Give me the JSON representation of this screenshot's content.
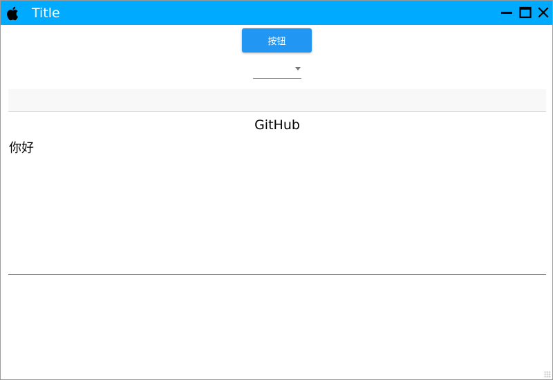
{
  "window": {
    "title": "Title",
    "titlebar_color": "#00aaff",
    "icons": {
      "app": "apple-logo-icon",
      "minimize": "minimize-icon",
      "maximize": "maximize-icon",
      "close": "close-icon"
    }
  },
  "content": {
    "button_label": "按钮",
    "button_color": "#2196f3",
    "combo": {
      "value": "",
      "icon": "chevron-down-icon"
    },
    "heading": "GitHub",
    "body_text": "你好",
    "accent_color": "#2a86d0"
  }
}
